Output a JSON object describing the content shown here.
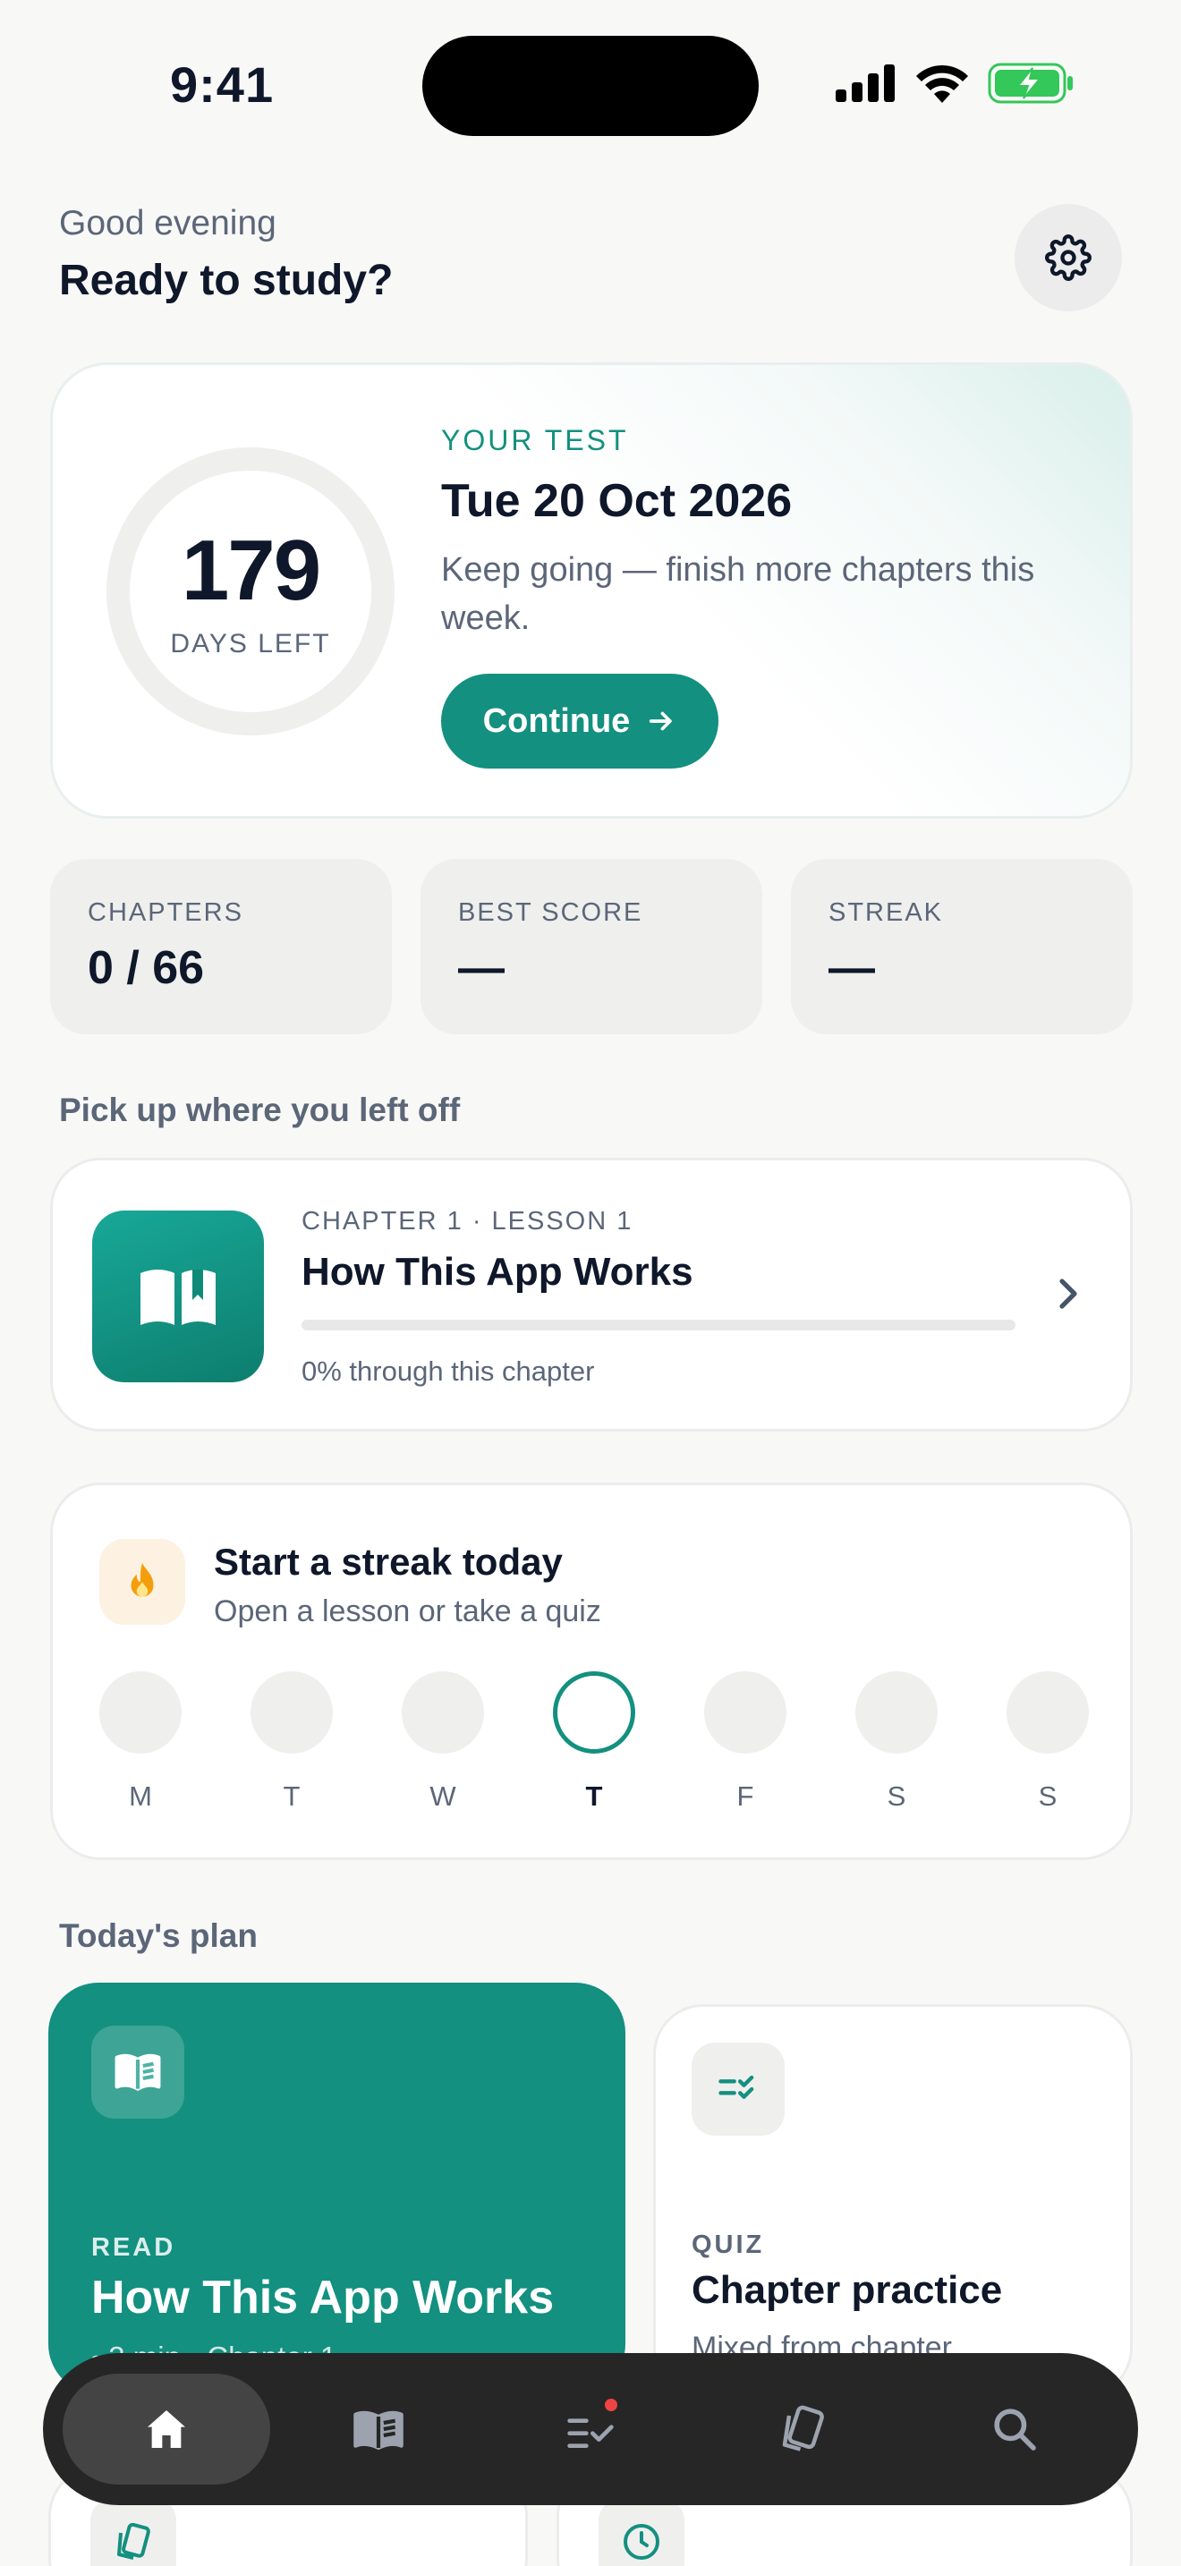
{
  "status_bar": {
    "time": "9:41"
  },
  "header": {
    "greeting": "Good evening",
    "headline": "Ready to study?"
  },
  "test_card": {
    "days_left": "179",
    "days_left_label": "DAYS LEFT",
    "kicker": "YOUR TEST",
    "date": "Tue 20 Oct 2026",
    "message": "Keep going — finish more chapters this week.",
    "continue_label": "Continue"
  },
  "stats": [
    {
      "label": "CHAPTERS",
      "value": "0 / 66"
    },
    {
      "label": "BEST SCORE",
      "value": "—"
    },
    {
      "label": "STREAK",
      "value": "—"
    }
  ],
  "resume": {
    "section_title": "Pick up where you left off",
    "kicker": "CHAPTER 1 · LESSON 1",
    "title": "How This App Works",
    "progress_percent": 0,
    "progress_text": "0% through this chapter"
  },
  "streak": {
    "title": "Start a streak today",
    "subtitle": "Open a lesson or take a quiz",
    "days": [
      "M",
      "T",
      "W",
      "T",
      "F",
      "S",
      "S"
    ],
    "today_index": 3
  },
  "plan": {
    "section_title": "Today's plan",
    "read": {
      "kicker": "READ",
      "title": "How This App Works",
      "subtitle": "~3 min · Chapter 1"
    },
    "quiz": {
      "kicker": "QUIZ",
      "title": "Chapter practice",
      "subtitle": "Mixed from chapter"
    }
  },
  "tabbar": {
    "tabs": [
      "home-icon",
      "book-icon",
      "checklist-icon",
      "cards-icon",
      "search-icon"
    ],
    "active_index": 0
  },
  "colors": {
    "accent": "#13907f",
    "text": "#0f172a",
    "muted": "#5b6678",
    "tabbar": "#262626"
  }
}
